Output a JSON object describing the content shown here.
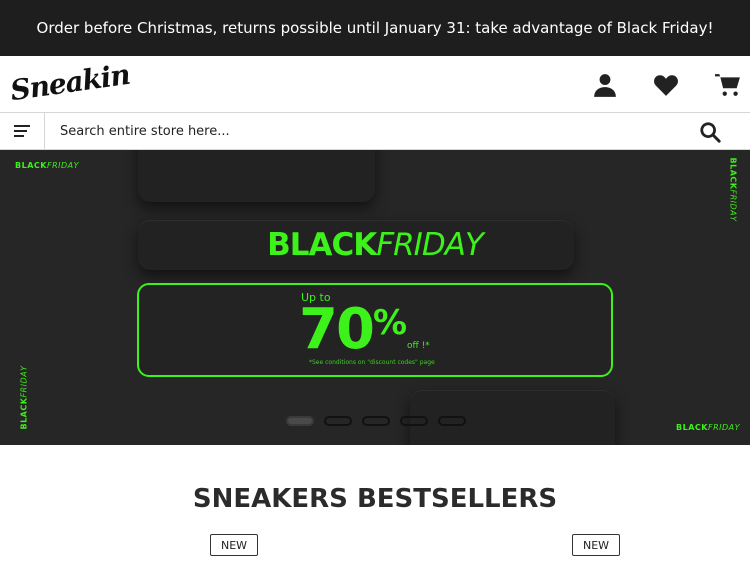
{
  "announcement": "Order before Christmas, returns possible until January 31: take advantage of Black Friday!",
  "header": {
    "logo_text": "Sneakin",
    "icons": [
      "account-icon",
      "wishlist-heart-icon",
      "cart-icon"
    ]
  },
  "search": {
    "placeholder": "Search entire store here...",
    "menu_icon": "hamburger-menu-icon",
    "search_icon": "search-icon"
  },
  "hero": {
    "tag_bold": "BLACK",
    "tag_italic": "FRIDAY",
    "title_bold": "BLACK",
    "title_italic": "FRIDAY",
    "up_to": "Up to",
    "discount_number": "70",
    "discount_sign": "%",
    "off_text": "off !*",
    "conditions_note": "*See conditions on \"discount codes\" page",
    "accent_color": "#3df21a",
    "slides_total": 5,
    "active_slide": 1
  },
  "bestsellers": {
    "title": "SNEAKERS BESTSELLERS",
    "badges": [
      "NEW",
      "NEW"
    ]
  }
}
